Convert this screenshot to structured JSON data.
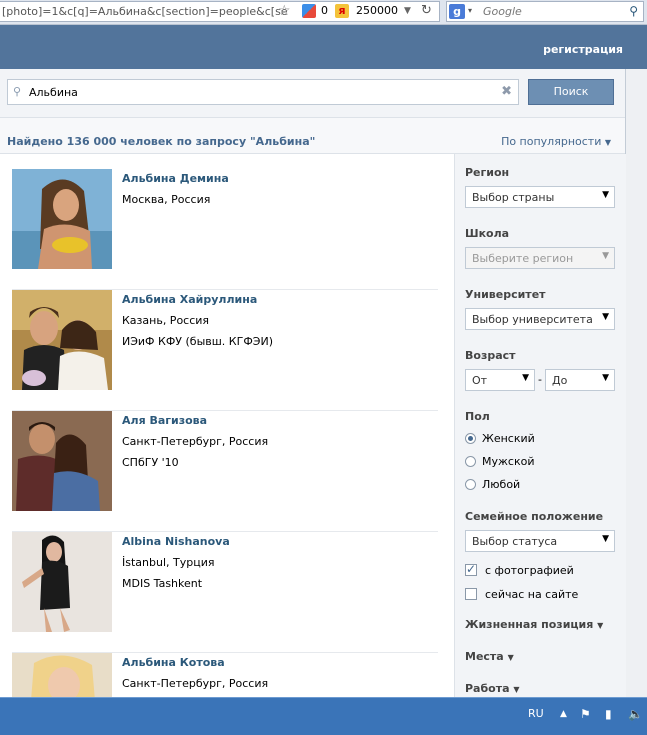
{
  "browser": {
    "url": "[photo]=1&c[q]=Альбина&c[section]=people&c[se",
    "google_count": "0",
    "yandex_count": "250000",
    "search_placeholder": "Google",
    "search_engine_badge": "g"
  },
  "header": {
    "register_label": "регистрация"
  },
  "search": {
    "query": "Альбина",
    "button_label": "Поиск"
  },
  "results": {
    "count_text": "Найдено 136 000 человек по запросу \"Альбина\"",
    "sort_label": "По популярности"
  },
  "people": [
    {
      "name": "Альбина Демина",
      "line1": "Москва, Россия",
      "line2": ""
    },
    {
      "name": "Альбина Хайруллина",
      "line1": "Казань, Россия",
      "line2": "ИЭиФ КФУ (бывш. КГФЭИ)"
    },
    {
      "name": "Аля Вагизова",
      "line1": "Санкт-Петербург, Россия",
      "line2": "СПбГУ '10"
    },
    {
      "name": "Albina Nishanova",
      "line1": "İstanbul, Турция",
      "line2": "MDIS Tashkent"
    },
    {
      "name": "Альбина Котова",
      "line1": "Санкт-Петербург, Россия",
      "line2": ""
    }
  ],
  "filters": {
    "region_label": "Регион",
    "country_select": "Выбор страны",
    "school_label": "Школа",
    "school_select": "Выберите регион",
    "university_label": "Университет",
    "university_select": "Выбор университета",
    "age_label": "Возраст",
    "age_from": "От",
    "age_dash": "-",
    "age_to": "До",
    "sex_label": "Пол",
    "sex_options": [
      "Женский",
      "Мужской",
      "Любой"
    ],
    "sex_selected": "Женский",
    "marital_label": "Семейное положение",
    "marital_select": "Выбор статуса",
    "with_photo_label": "с фотографией",
    "with_photo_checked": true,
    "online_label": "сейчас на сайте",
    "online_checked": false,
    "life_position_label": "Жизненная позиция",
    "places_label": "Места",
    "work_label": "Работа"
  },
  "taskbar": {
    "language": "RU"
  },
  "colors": {
    "header_bg": "#52749b",
    "link": "#2b587a",
    "button_bg": "#6d8fb3",
    "taskbar_bg": "#3a74b8"
  }
}
